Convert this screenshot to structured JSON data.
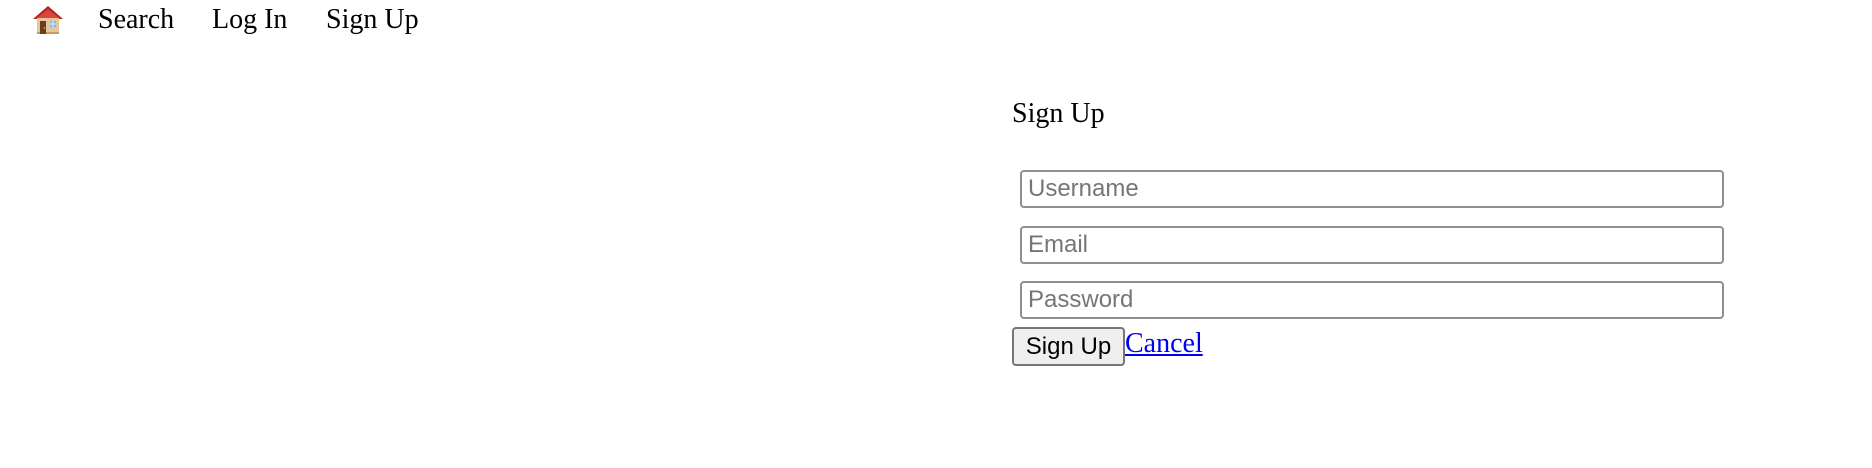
{
  "nav": {
    "home_icon": "house-icon",
    "items": [
      {
        "label": "Search"
      },
      {
        "label": "Log In"
      },
      {
        "label": "Sign Up"
      }
    ]
  },
  "signup_form": {
    "title": "Sign Up",
    "username_placeholder": "Username",
    "email_placeholder": "Email",
    "password_placeholder": "Password",
    "submit_label": "Sign Up",
    "cancel_label": "Cancel"
  },
  "colors": {
    "link": "#0000ee",
    "input_border": "#8f8f8f",
    "button_background": "#efefef",
    "placeholder": "#767676"
  }
}
